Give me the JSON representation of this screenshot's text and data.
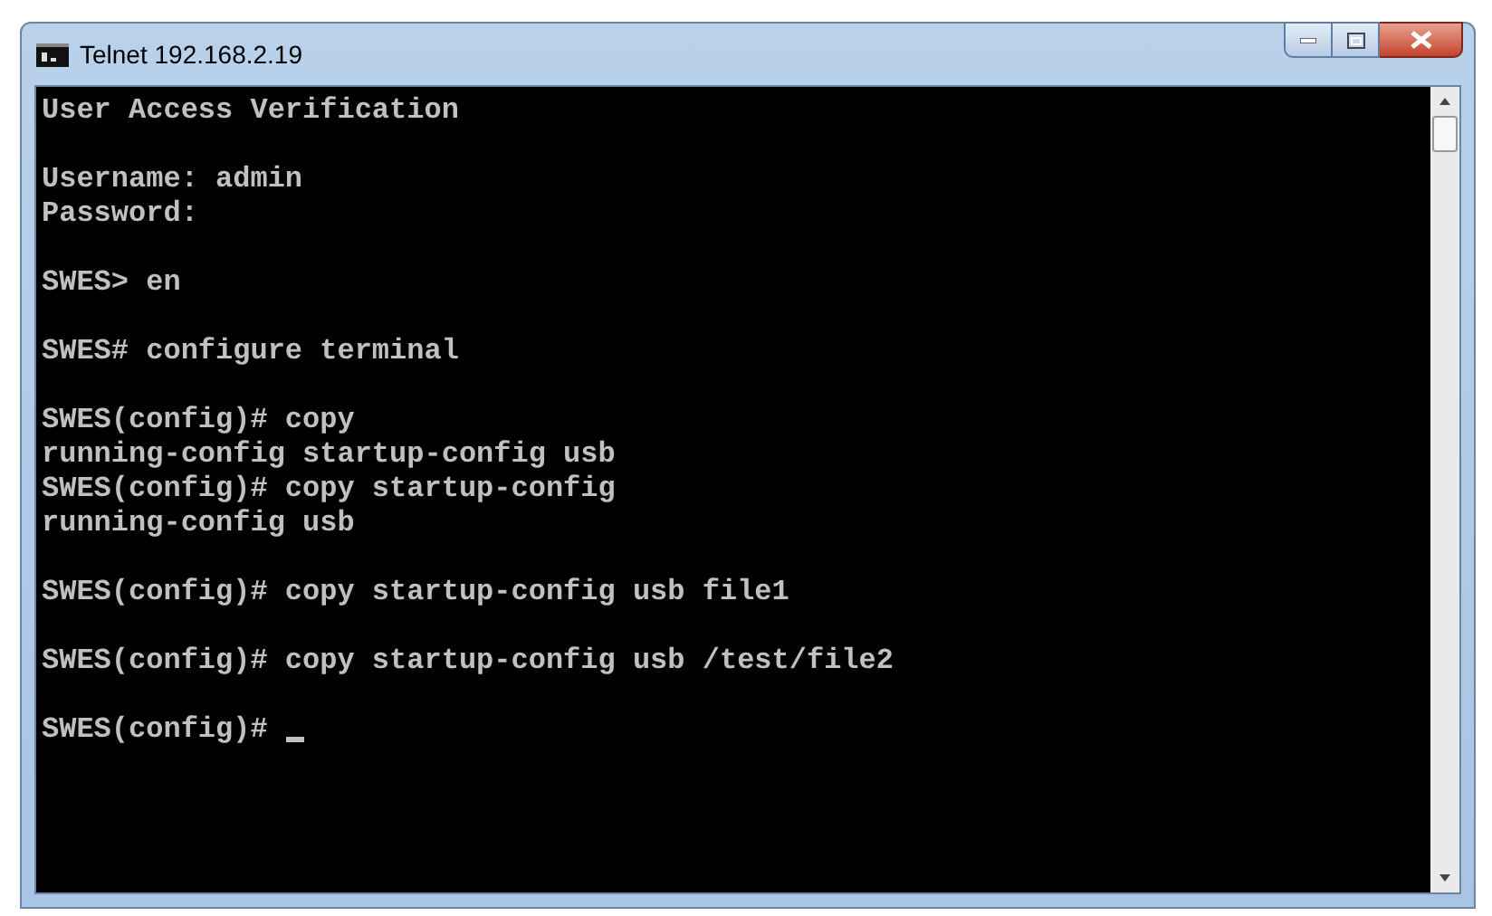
{
  "window": {
    "title": "Telnet 192.168.2.19"
  },
  "terminal": {
    "blocks": [
      [
        "User Access Verification"
      ],
      [
        "Username: admin",
        "Password:"
      ],
      [
        "SWES> en"
      ],
      [
        "SWES# configure terminal"
      ],
      [
        "SWES(config)# copy",
        "running-config startup-config usb",
        "SWES(config)# copy startup-config",
        "running-config usb"
      ],
      [
        "SWES(config)# copy startup-config usb file1"
      ],
      [
        "SWES(config)# copy startup-config usb /test/file2"
      ],
      [
        "SWES(config)#"
      ]
    ]
  }
}
